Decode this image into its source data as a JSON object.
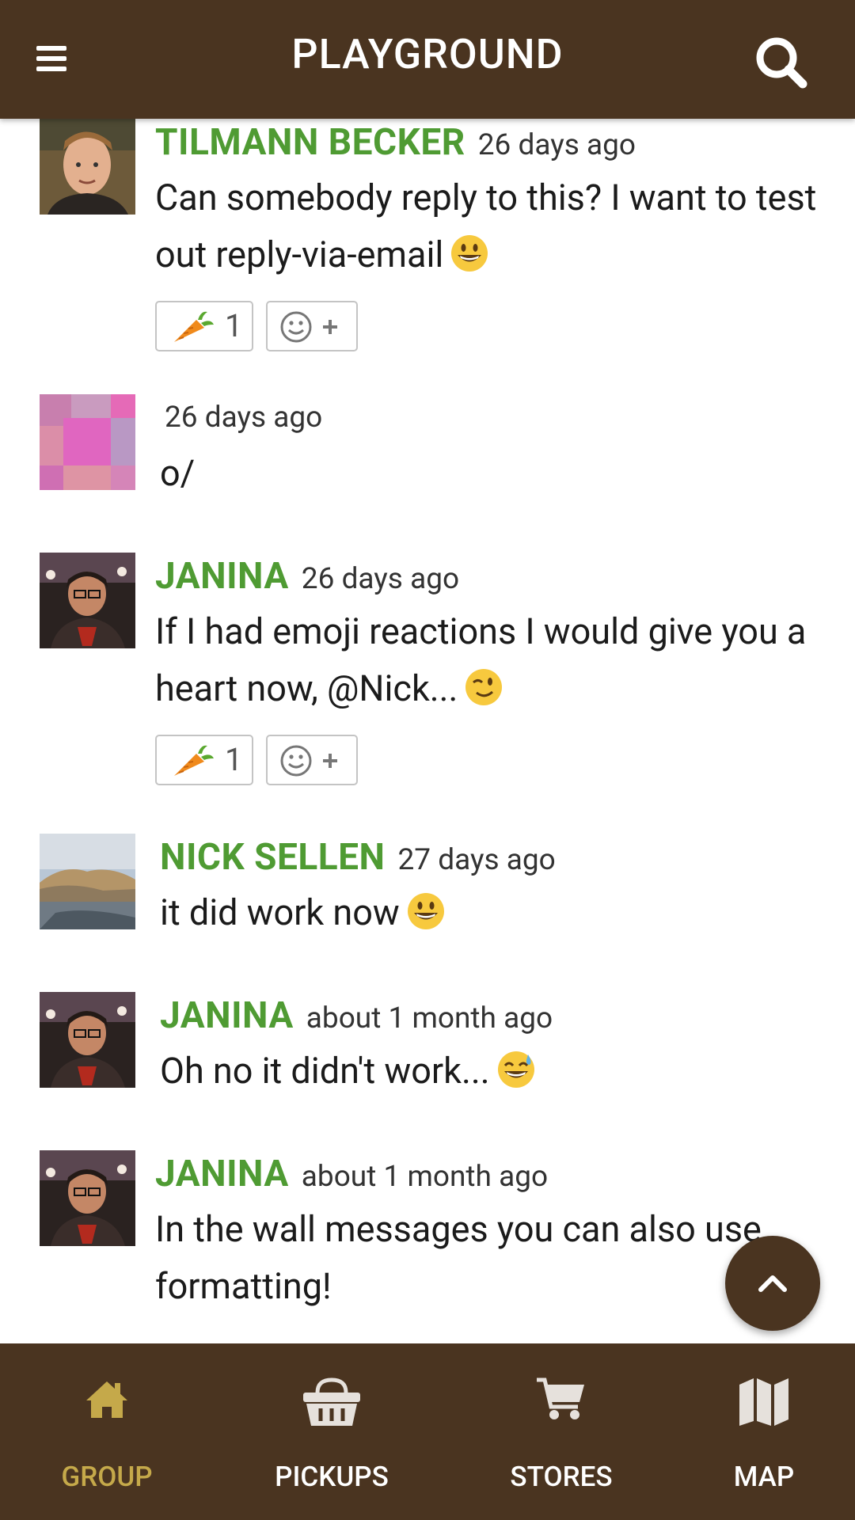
{
  "header": {
    "title": "PLAYGROUND"
  },
  "messages": [
    {
      "author": "TILMANN BECKER",
      "time": "26 days ago",
      "text": "Can somebody reply to this? I want to test out reply-via-email",
      "emoji": "smiley",
      "reaction_count": "1"
    },
    {
      "author": "",
      "time": "26 days ago",
      "text": "o/"
    },
    {
      "author": "JANINA",
      "time": "26 days ago",
      "text": "If I had emoji reactions I would give you a heart now, @Nick...",
      "emoji": "wink",
      "reaction_count": "1"
    },
    {
      "author": "NICK SELLEN",
      "time": "27 days ago",
      "text": "it did work now",
      "emoji": "smiley"
    },
    {
      "author": "JANINA",
      "time": "about 1 month ago",
      "text": "Oh no it didn't work...",
      "emoji": "sweat-smile"
    },
    {
      "author": "JANINA",
      "time": "about 1 month ago",
      "text": "In the wall messages you can also use formatting!"
    }
  ],
  "nav": [
    {
      "label": "GROUP",
      "icon": "home-icon",
      "active": true
    },
    {
      "label": "PICKUPS",
      "icon": "basket-icon",
      "active": false
    },
    {
      "label": "STORES",
      "icon": "cart-icon",
      "active": false
    },
    {
      "label": "MAP",
      "icon": "map-icon",
      "active": false
    }
  ],
  "colors": {
    "primary": "#4a3420",
    "author": "#4f9b33",
    "active_nav": "#c5a94a"
  }
}
